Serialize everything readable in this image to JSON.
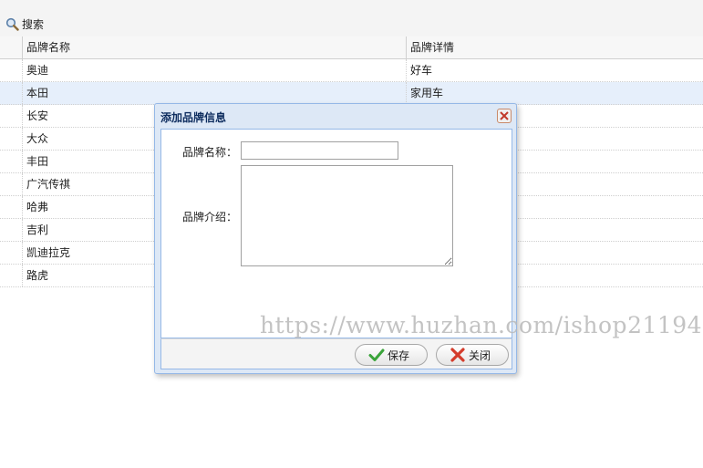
{
  "toolbar": {
    "search_label": "搜索"
  },
  "grid": {
    "headers": {
      "name": "品牌名称",
      "detail": "品牌详情"
    },
    "rows": [
      {
        "name": "奥迪",
        "detail": "好车"
      },
      {
        "name": "本田",
        "detail": "家用车"
      },
      {
        "name": "长安",
        "detail": ""
      },
      {
        "name": "大众",
        "detail": ""
      },
      {
        "name": "丰田",
        "detail": ""
      },
      {
        "name": "广汽传祺",
        "detail": ""
      },
      {
        "name": "哈弗",
        "detail": ""
      },
      {
        "name": "吉利",
        "detail": ""
      },
      {
        "name": "凯迪拉克",
        "detail": ""
      },
      {
        "name": "路虎",
        "detail": ""
      }
    ],
    "selected_row": 1
  },
  "dialog": {
    "title": "添加品牌信息",
    "name_label": "品牌名称：",
    "name_value": "",
    "intro_label": "品牌介绍：",
    "intro_value": "",
    "save_label": "保存",
    "close_label": "关闭"
  },
  "watermark": "https://www.huzhan.com/ishop21194",
  "colors": {
    "selected_row": "#e6effb",
    "dialog_border": "#95b8e7",
    "dialog_header": "#dde8f6"
  }
}
